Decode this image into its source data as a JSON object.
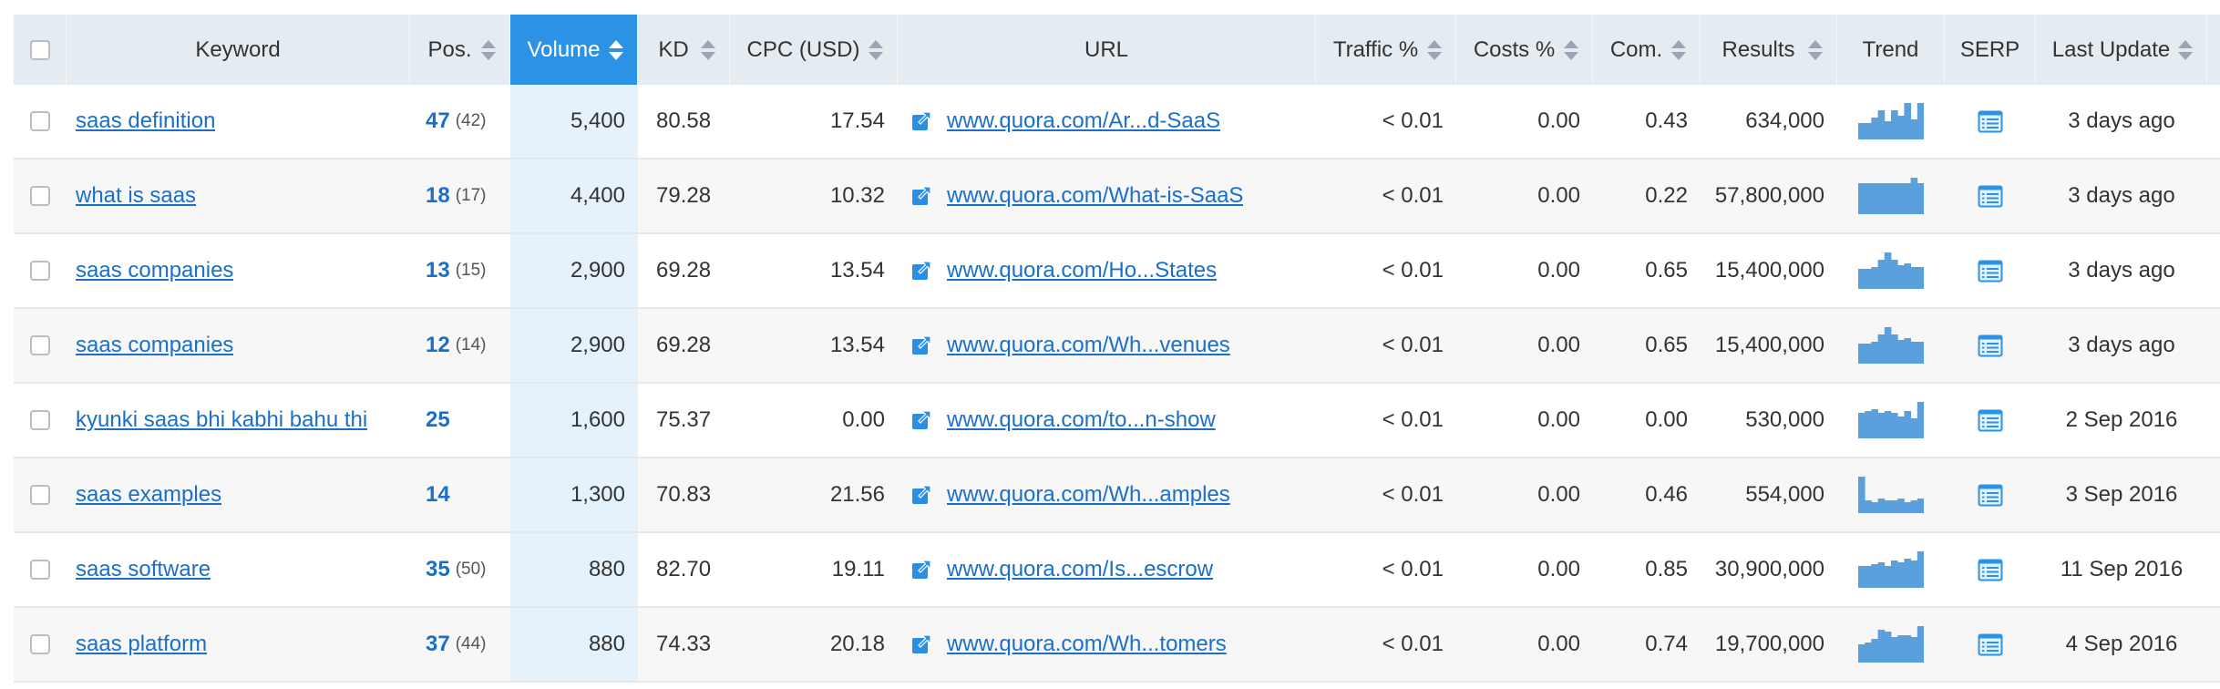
{
  "header": {
    "keyword": "Keyword",
    "pos": "Pos.",
    "volume": "Volume",
    "kd": "KD",
    "cpc": "CPC (USD)",
    "url": "URL",
    "traffic": "Traffic %",
    "costs": "Costs %",
    "com": "Com.",
    "results": "Results",
    "trend": "Trend",
    "serp": "SERP",
    "last_update": "Last Update"
  },
  "rows": [
    {
      "keyword": "saas definition",
      "pos": "47",
      "prev": "(42)",
      "volume": "5,400",
      "kd": "80.58",
      "cpc": "17.54",
      "url": "www.quora.com/Ar...d-SaaS",
      "traffic": "< 0.01",
      "costs": "0.00",
      "com": "0.43",
      "results": "634,000",
      "trend": [
        0.45,
        0.45,
        0.6,
        0.8,
        0.5,
        0.8,
        0.65,
        1.0,
        0.55,
        1.0
      ],
      "updated": "3 days ago"
    },
    {
      "keyword": "what is saas",
      "pos": "18",
      "prev": "(17)",
      "volume": "4,400",
      "kd": "79.28",
      "cpc": "10.32",
      "url": "www.quora.com/What-is-SaaS",
      "traffic": "< 0.01",
      "costs": "0.00",
      "com": "0.22",
      "results": "57,800,000",
      "trend": [
        0.85,
        0.85,
        0.85,
        0.85,
        0.85,
        0.85,
        0.85,
        0.85,
        1.0,
        0.85
      ],
      "updated": "3 days ago"
    },
    {
      "keyword": "saas companies",
      "pos": "13",
      "prev": "(15)",
      "volume": "2,900",
      "kd": "69.28",
      "cpc": "13.54",
      "url": "www.quora.com/Ho...States",
      "traffic": "< 0.01",
      "costs": "0.00",
      "com": "0.65",
      "results": "15,400,000",
      "trend": [
        0.55,
        0.55,
        0.6,
        0.8,
        1.0,
        0.8,
        0.65,
        0.7,
        0.6,
        0.6
      ],
      "updated": "3 days ago"
    },
    {
      "keyword": "saas companies",
      "pos": "12",
      "prev": "(14)",
      "volume": "2,900",
      "kd": "69.28",
      "cpc": "13.54",
      "url": "www.quora.com/Wh...venues",
      "traffic": "< 0.01",
      "costs": "0.00",
      "com": "0.65",
      "results": "15,400,000",
      "trend": [
        0.55,
        0.55,
        0.6,
        0.8,
        1.0,
        0.8,
        0.65,
        0.7,
        0.6,
        0.6
      ],
      "updated": "3 days ago"
    },
    {
      "keyword": "kyunki saas bhi kabhi bahu thi",
      "pos": "25",
      "prev": "",
      "volume": "1,600",
      "kd": "75.37",
      "cpc": "0.00",
      "url": "www.quora.com/to...n-show",
      "traffic": "< 0.01",
      "costs": "0.00",
      "com": "0.00",
      "results": "530,000",
      "trend": [
        0.7,
        0.75,
        0.8,
        0.7,
        0.75,
        0.7,
        0.6,
        0.75,
        0.55,
        1.0
      ],
      "updated": "2 Sep 2016"
    },
    {
      "keyword": "saas examples",
      "pos": "14",
      "prev": "",
      "volume": "1,300",
      "kd": "70.83",
      "cpc": "21.56",
      "url": "www.quora.com/Wh...amples",
      "traffic": "< 0.01",
      "costs": "0.00",
      "com": "0.46",
      "results": "554,000",
      "trend": [
        1.0,
        0.35,
        0.3,
        0.4,
        0.35,
        0.35,
        0.4,
        0.3,
        0.35,
        0.4
      ],
      "updated": "3 Sep 2016"
    },
    {
      "keyword": "saas software",
      "pos": "35",
      "prev": "(50)",
      "volume": "880",
      "kd": "82.70",
      "cpc": "19.11",
      "url": "www.quora.com/Is...escrow",
      "traffic": "< 0.01",
      "costs": "0.00",
      "com": "0.85",
      "results": "30,900,000",
      "trend": [
        0.6,
        0.6,
        0.65,
        0.7,
        0.6,
        0.75,
        0.7,
        0.8,
        0.75,
        1.0
      ],
      "updated": "11 Sep 2016"
    },
    {
      "keyword": "saas platform",
      "pos": "37",
      "prev": "(44)",
      "volume": "880",
      "kd": "74.33",
      "cpc": "20.18",
      "url": "www.quora.com/Wh...tomers",
      "traffic": "< 0.01",
      "costs": "0.00",
      "com": "0.74",
      "results": "19,700,000",
      "trend": [
        0.5,
        0.55,
        0.65,
        0.9,
        0.85,
        0.7,
        0.75,
        0.75,
        0.7,
        1.0
      ],
      "updated": "4 Sep 2016"
    }
  ],
  "icons": {
    "checkbox": "checkbox-icon",
    "sort": "sort-arrows-icon",
    "external": "external-link-icon",
    "serp": "serp-icon"
  },
  "colors": {
    "link": "#1a6fc9",
    "active_header": "#2c92e6",
    "trend_bar": "#5aa0dd",
    "header_bg": "#e4ebf1"
  }
}
